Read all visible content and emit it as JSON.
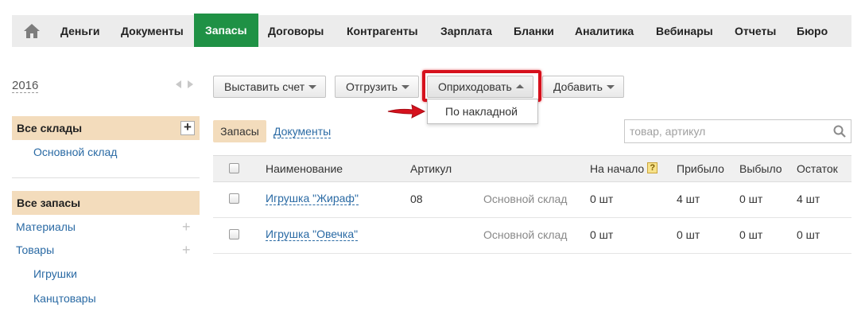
{
  "nav": {
    "items": [
      {
        "label": "Деньги"
      },
      {
        "label": "Документы"
      },
      {
        "label": "Запасы"
      },
      {
        "label": "Договоры"
      },
      {
        "label": "Контрагенты"
      },
      {
        "label": "Зарплата"
      },
      {
        "label": "Бланки"
      },
      {
        "label": "Аналитика"
      },
      {
        "label": "Вебинары"
      },
      {
        "label": "Отчеты"
      },
      {
        "label": "Бюро"
      }
    ],
    "active": "Запасы",
    "active_color": "#1f9145"
  },
  "sidebar": {
    "year": "2016",
    "warehouses_header": "Все склады",
    "warehouses": [
      {
        "label": "Основной склад"
      }
    ],
    "stock_header": "Все запасы",
    "categories": [
      {
        "label": "Материалы"
      },
      {
        "label": "Товары"
      }
    ],
    "subcategories": [
      {
        "label": "Игрушки"
      },
      {
        "label": "Канцтовары"
      }
    ]
  },
  "toolbar": {
    "invoice_label": "Выставить счет",
    "ship_label": "Отгрузить",
    "receive_label": "Оприходовать",
    "add_label": "Добавить",
    "receive_menu": [
      {
        "label": "По накладной"
      }
    ],
    "highlight_color": "#d6111d"
  },
  "tabs": {
    "active_label": "Запасы",
    "documents_label": "Документы"
  },
  "search": {
    "placeholder": "товар, артикул",
    "value": ""
  },
  "table": {
    "headers": {
      "name": "Наименование",
      "article": "Артикул",
      "start": "На начало",
      "help": "?",
      "arrived": "Прибыло",
      "left": "Выбыло",
      "remaining": "Остаток"
    },
    "rows": [
      {
        "name": "Игрушка \"Жираф\"",
        "article": "08",
        "warehouse": "Основной склад",
        "start": "0 шт",
        "arrived": "4 шт",
        "left": "0 шт",
        "remaining": "4 шт"
      },
      {
        "name": "Игрушка \"Овечка\"",
        "article": "",
        "warehouse": "Основной склад",
        "start": "0 шт",
        "arrived": "0 шт",
        "left": "0 шт",
        "remaining": "0 шт"
      }
    ]
  }
}
